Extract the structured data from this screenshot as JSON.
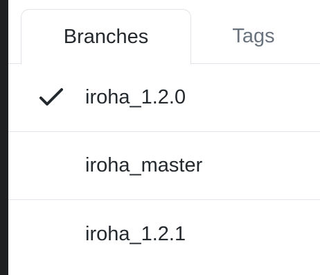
{
  "tabs": [
    {
      "label": "Branches",
      "selected": true
    },
    {
      "label": "Tags",
      "selected": false
    }
  ],
  "branches": [
    {
      "name": "iroha_1.2.0",
      "checked": true,
      "icon": "check-icon"
    },
    {
      "name": "iroha_master",
      "checked": false
    },
    {
      "name": "iroha_1.2.1",
      "checked": false
    }
  ],
  "colors": {
    "text": "#24292e",
    "muted": "#6a737d",
    "border": "#e1e4e8",
    "edge": "#1e1f21"
  }
}
